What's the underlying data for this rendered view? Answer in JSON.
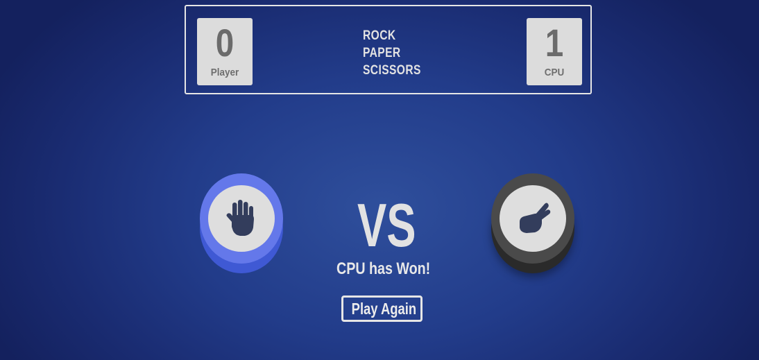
{
  "scoreboard": {
    "player": {
      "score": "0",
      "label": "Player"
    },
    "cpu": {
      "score": "1",
      "label": "CPU"
    },
    "title_lines": [
      "ROCK",
      "PAPER",
      "SCISSORS"
    ]
  },
  "match": {
    "player_choice": {
      "icon": "paper-hand-icon",
      "ring_color": "#6478ea"
    },
    "cpu_choice": {
      "icon": "scissors-hand-icon",
      "ring_color": "#4a4a4a"
    },
    "vs_label": "VS",
    "result_text": "CPU has Won!",
    "play_again_label": "Play Again"
  },
  "colors": {
    "icon_color": "#333d5c",
    "score_box": "#dcdcdc"
  }
}
